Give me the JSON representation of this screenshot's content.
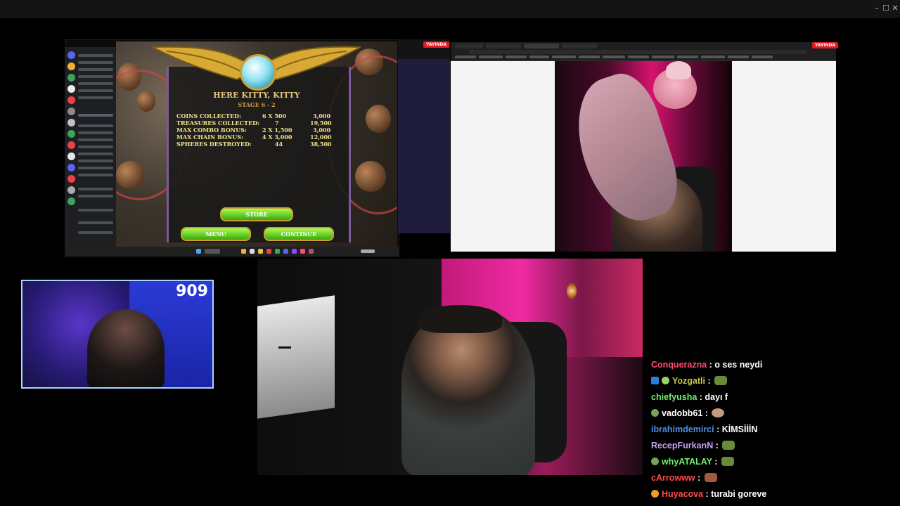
{
  "window": {
    "minimize": "–",
    "maximize": "☐",
    "close": "✕"
  },
  "stream_badge": "YAYINDA",
  "game": {
    "level_name": "HERE KITTY, KITTY",
    "stage": "STAGE 6 - 2",
    "stats": [
      {
        "label": "COINS COLLECTED:",
        "mult": "6 X 500",
        "value": "3,000"
      },
      {
        "label": "TREASURES COLLECTED:",
        "mult": "7",
        "value": "19,500"
      },
      {
        "label": "MAX COMBO BONUS:",
        "mult": "2 X 1,500",
        "value": "3,000"
      },
      {
        "label": "MAX CHAIN BONUS:",
        "mult": "4 X 3,000",
        "value": "12,000"
      },
      {
        "label": "SPHERES DESTROYED:",
        "mult": "44",
        "value": "38,500"
      }
    ],
    "buttons": {
      "store": "STORE",
      "menu": "MENU",
      "continue": "CONTINUE"
    }
  },
  "webcam_small": {
    "counter": "909",
    "accent": "#a8d4ff"
  },
  "chat": [
    {
      "user": "Conquerazna",
      "color": "#ff4b6e",
      "message": "o ses neydi",
      "badge": "",
      "emote": ""
    },
    {
      "user": "Yozgatli",
      "color": "#c8c84a",
      "message": "",
      "badge": "badge-icon",
      "emote": "frog-emote"
    },
    {
      "user": "chiefyusha",
      "color": "#6ef06e",
      "message": "dayı f",
      "badge": "",
      "emote": ""
    },
    {
      "user": "vadobb61",
      "color": "#ffffff",
      "message": "",
      "badge": "frog-badge",
      "emote": "face-emote"
    },
    {
      "user": "ibrahimdemirci",
      "color": "#4a8ee8",
      "message": "KİMSİİİN",
      "badge": "",
      "emote": ""
    },
    {
      "user": "RecepFurkanN",
      "color": "#c8a0f0",
      "message": "",
      "badge": "",
      "emote": "frog-emote"
    },
    {
      "user": "whyATALAY",
      "color": "#6ef06e",
      "message": "",
      "badge": "frog-badge",
      "emote": "frog-emote"
    },
    {
      "user": "cArrowww",
      "color": "#ff4b4b",
      "message": "",
      "badge": "",
      "emote": "face-emote"
    },
    {
      "user": "Huyacova",
      "color": "#ff4b4b",
      "message": "turabi goreve",
      "badge": "star-badge",
      "emote": ""
    }
  ]
}
